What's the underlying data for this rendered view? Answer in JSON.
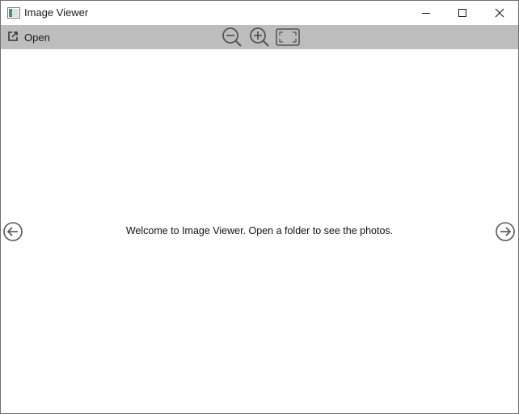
{
  "window": {
    "title": "Image Viewer",
    "icon": "image-viewer-app-icon"
  },
  "titlebar_controls": {
    "minimize_icon": "minimize-icon",
    "maximize_icon": "maximize-icon",
    "close_icon": "close-icon"
  },
  "toolbar": {
    "open_label": "Open",
    "open_icon": "open-external-icon",
    "zoom_out_icon": "zoom-out-icon",
    "zoom_in_icon": "zoom-in-icon",
    "fit_icon": "fit-to-window-icon"
  },
  "content": {
    "welcome_message": "Welcome to Image Viewer. Open a folder to see the photos.",
    "prev_icon": "arrow-left-circle-icon",
    "next_icon": "arrow-right-circle-icon"
  },
  "colors": {
    "toolbar_background": "#bdbdbd",
    "icon_color": "#555555",
    "window_border": "#6f6f6f"
  }
}
